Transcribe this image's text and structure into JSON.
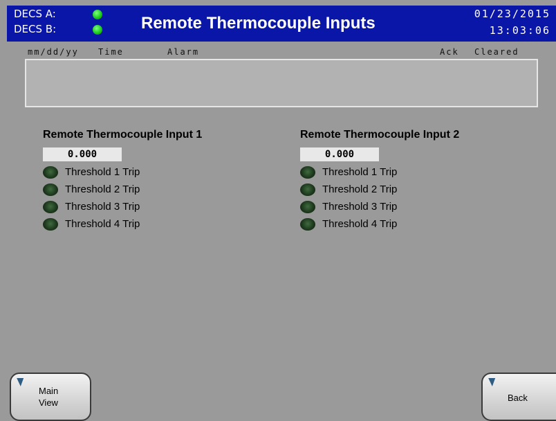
{
  "header": {
    "decs_a_label": "DECS A:",
    "decs_b_label": "DECS B:",
    "title": "Remote Thermocouple Inputs",
    "date": "01/23/2015",
    "time": "13:03:06",
    "decs_a_status": "on",
    "decs_b_status": "on",
    "background_color": "#0a16a8"
  },
  "alarm_table": {
    "col_date": "mm/dd/yy",
    "col_time": "Time",
    "col_alarm": "Alarm",
    "col_ack": "Ack",
    "col_cleared": "Cleared",
    "rows": []
  },
  "inputs": [
    {
      "title": "Remote Thermocouple Input 1",
      "value": "0.000",
      "thresholds": [
        {
          "label": "Threshold 1 Trip",
          "state": "off"
        },
        {
          "label": "Threshold 2 Trip",
          "state": "off"
        },
        {
          "label": "Threshold 3 Trip",
          "state": "off"
        },
        {
          "label": "Threshold 4 Trip",
          "state": "off"
        }
      ]
    },
    {
      "title": "Remote Thermocouple Input 2",
      "value": "0.000",
      "thresholds": [
        {
          "label": "Threshold 1 Trip",
          "state": "off"
        },
        {
          "label": "Threshold 2 Trip",
          "state": "off"
        },
        {
          "label": "Threshold 3 Trip",
          "state": "off"
        },
        {
          "label": "Threshold 4 Trip",
          "state": "off"
        }
      ]
    }
  ],
  "buttons": {
    "main_view_label_1": "Main",
    "main_view_label_2": "View",
    "back_label": "Back"
  }
}
